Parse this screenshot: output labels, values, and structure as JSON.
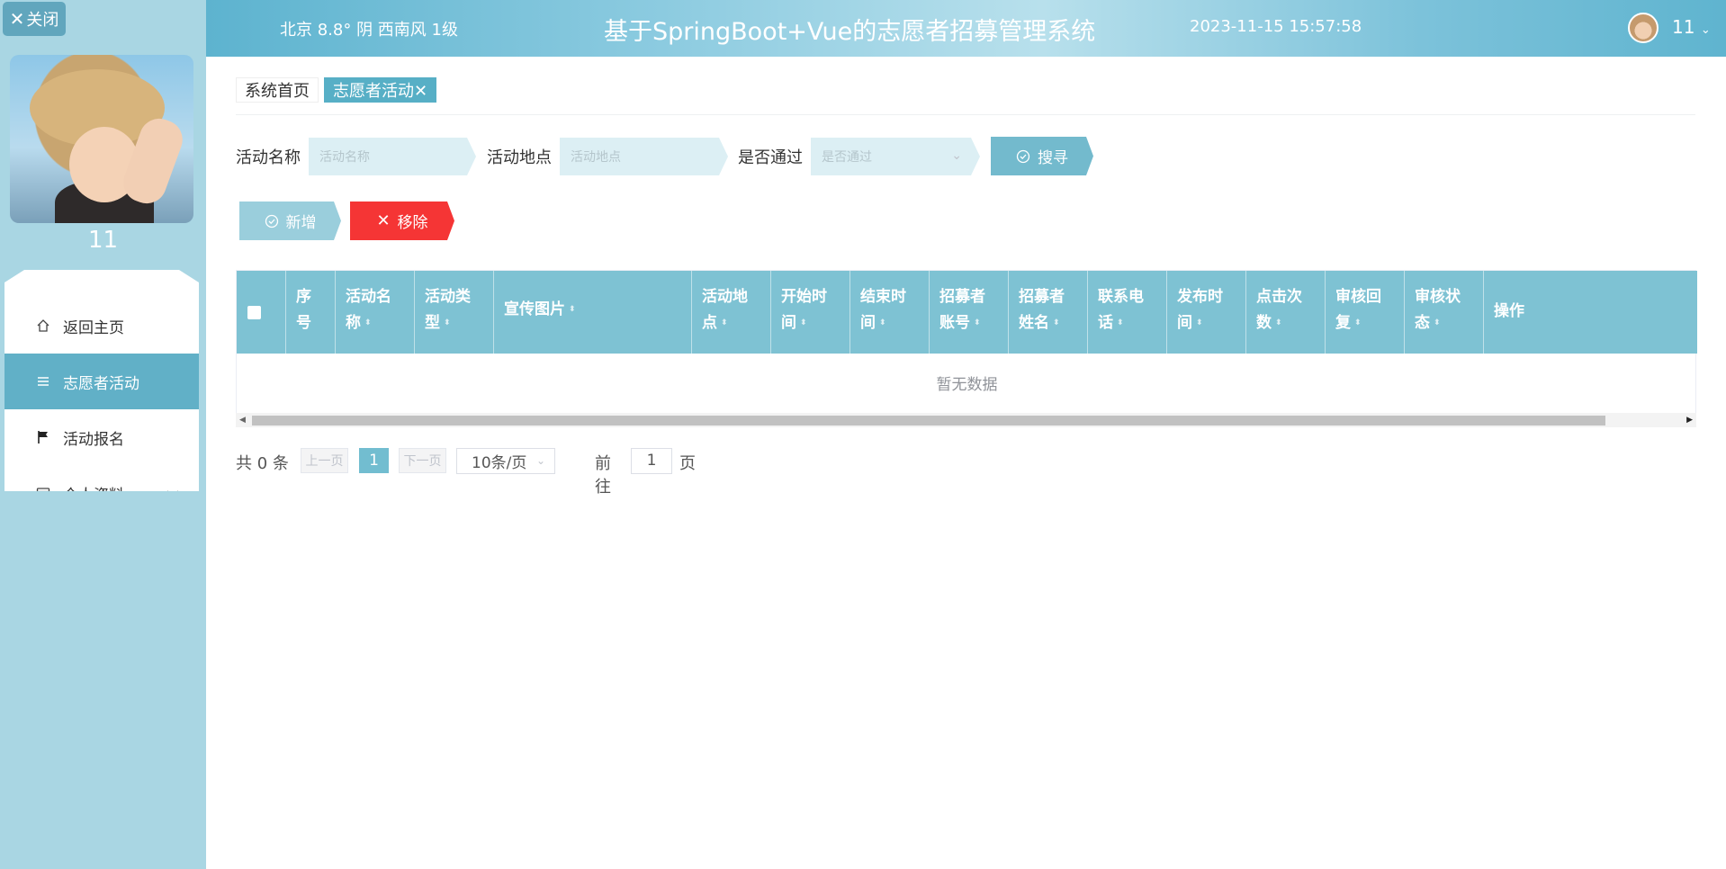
{
  "sidebar": {
    "close_label": "关闭",
    "username": "11",
    "menu": [
      {
        "label": "返回主页",
        "icon": "home-icon"
      },
      {
        "label": "志愿者活动",
        "icon": "list-icon",
        "active": true
      },
      {
        "label": "活动报名",
        "icon": "flag-icon"
      },
      {
        "label": "个人资料",
        "icon": "card-icon"
      }
    ]
  },
  "header": {
    "weather": "北京  8.8°  阴  西南风  1级",
    "title": "基于SpringBoot+Vue的志愿者招募管理系统",
    "datetime": "2023-11-15 15:57:58",
    "user": "11"
  },
  "tabs": [
    {
      "label": "系统首页"
    },
    {
      "label": "志愿者活动✕",
      "active": true
    }
  ],
  "search": {
    "name_label": "活动名称",
    "name_placeholder": "活动名称",
    "place_label": "活动地点",
    "place_placeholder": "活动地点",
    "pass_label": "是否通过",
    "pass_placeholder": "是否通过",
    "search_btn": "搜寻"
  },
  "actions": {
    "add": "新增",
    "remove": "移除"
  },
  "table": {
    "columns": [
      [
        "序",
        "号"
      ],
      [
        "活动名",
        "称"
      ],
      [
        "活动类",
        "型"
      ],
      [
        "宣传图片",
        ""
      ],
      [
        "活动地",
        "点"
      ],
      [
        "开始时",
        "间"
      ],
      [
        "结束时",
        "间"
      ],
      [
        "招募者",
        "账号"
      ],
      [
        "招募者",
        "姓名"
      ],
      [
        "联系电",
        "话"
      ],
      [
        "发布时",
        "间"
      ],
      [
        "点击次",
        "数"
      ],
      [
        "审核回",
        "复"
      ],
      [
        "审核状",
        "态"
      ],
      [
        "操作",
        ""
      ]
    ],
    "empty_text": "暂无数据"
  },
  "pager": {
    "total": "共 0 条",
    "prev": "上一页",
    "current": "1",
    "next": "下一页",
    "page_size": "10条/页",
    "goto_label": "前往",
    "goto_value": "1",
    "goto_suffix": "页"
  },
  "colors": {
    "accent": "#57afc6",
    "danger": "#f53535",
    "sidebar_bg": "#a9d6e3"
  }
}
